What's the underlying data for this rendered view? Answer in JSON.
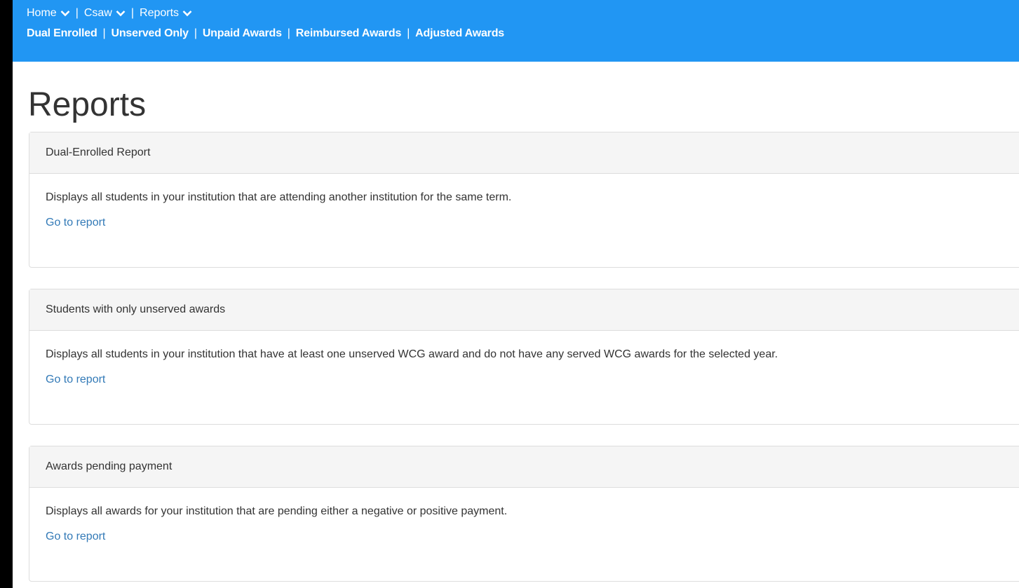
{
  "nav": {
    "primary": [
      {
        "label": "Home",
        "name": "nav-home"
      },
      {
        "label": "Csaw",
        "name": "nav-csaw"
      },
      {
        "label": "Reports",
        "name": "nav-reports"
      }
    ],
    "secondary": [
      {
        "label": "Dual Enrolled"
      },
      {
        "label": "Unserved Only"
      },
      {
        "label": "Unpaid Awards"
      },
      {
        "label": "Reimbursed Awards"
      },
      {
        "label": "Adjusted Awards"
      }
    ],
    "separator": "|"
  },
  "page": {
    "title": "Reports"
  },
  "panels": [
    {
      "heading": "Dual-Enrolled Report",
      "description": "Displays all students in your institution that are attending another institution for the same term.",
      "link": "Go to report"
    },
    {
      "heading": "Students with only unserved awards",
      "description": "Displays all students in your institution that have at least one unserved WCG award and do not have any served WCG awards for the selected year.",
      "link": "Go to report"
    },
    {
      "heading": "Awards pending payment",
      "description": "Displays all awards for your institution that are pending either a negative or positive payment.",
      "link": "Go to report"
    }
  ],
  "colors": {
    "nav_bg": "#2196f3",
    "link": "#337ab7",
    "panel_heading_bg": "#f5f5f5"
  }
}
